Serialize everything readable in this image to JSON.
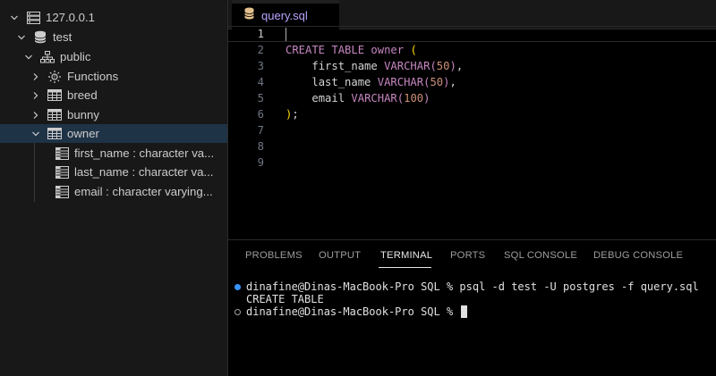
{
  "sidebar": {
    "server": "127.0.0.1",
    "database": "test",
    "schema": "public",
    "items": [
      {
        "label": "Functions",
        "icon": "functions-icon"
      },
      {
        "label": "breed",
        "icon": "table-icon"
      },
      {
        "label": "bunny",
        "icon": "table-icon"
      },
      {
        "label": "owner",
        "icon": "table-icon"
      }
    ],
    "columns": [
      "first_name : character va...",
      "last_name : character va...",
      "email : character varying..."
    ]
  },
  "editor": {
    "tab_label": "query.sql",
    "line_numbers": [
      "1",
      "2",
      "3",
      "4",
      "5",
      "6",
      "7",
      "8",
      "9"
    ],
    "code": {
      "l2_kw": "CREATE TABLE",
      "l2_name": "owner",
      "l2_paren": "(",
      "l3_col": "first_name",
      "l3_type": "VARCHAR",
      "l3_open": "(",
      "l3_num": "50",
      "l3_close": ")",
      "l3_comma": ",",
      "l4_col": "last_name",
      "l4_type": "VARCHAR",
      "l4_open": "(",
      "l4_num": "50",
      "l4_close": ")",
      "l4_comma": ",",
      "l5_col": "email",
      "l5_type": "VARCHAR",
      "l5_open": "(",
      "l5_num": "100",
      "l5_close": ")",
      "l6_close": ")",
      "l6_semi": ";"
    }
  },
  "panel": {
    "tabs": [
      "PROBLEMS",
      "OUTPUT",
      "TERMINAL",
      "PORTS",
      "SQL CONSOLE",
      "DEBUG CONSOLE"
    ],
    "active_tab": "TERMINAL",
    "terminal": {
      "line1": "dinafine@Dinas-MacBook-Pro SQL % psql -d test -U postgres -f query.sql",
      "line2": "CREATE TABLE",
      "line3": "dinafine@Dinas-MacBook-Pro SQL % "
    }
  },
  "colors": {
    "accent": "#0078d4",
    "selection": "#1f3347",
    "keyword": "#c586c0",
    "number": "#ce9178",
    "bracket": "#ffd700",
    "terminal_dot": "#3794ff"
  }
}
